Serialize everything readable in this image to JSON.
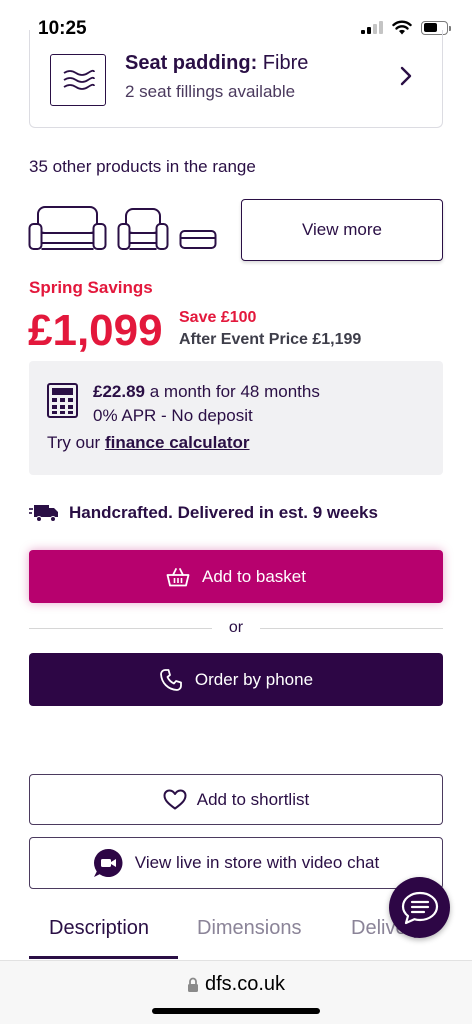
{
  "status_bar": {
    "time": "10:25"
  },
  "padding_card": {
    "title_label": "Seat padding:",
    "title_value": "Fibre",
    "subtitle": "2 seat fillings available"
  },
  "range": {
    "text": "35 other products in the range",
    "view_more_label": "View more"
  },
  "pricing": {
    "promo_label": "Spring Savings",
    "price": "£1,099",
    "save_text": "Save £100",
    "after_event_text": "After Event Price £1,199"
  },
  "finance": {
    "monthly_amount": "£22.89",
    "monthly_rest": "a month for 48 months",
    "apr_text": "0% APR - No deposit",
    "try_text": "Try our",
    "link_text": "finance calculator"
  },
  "delivery": {
    "text": "Handcrafted. Delivered in est. 9 weeks"
  },
  "actions": {
    "add_to_basket": "Add to basket",
    "or_text": "or",
    "order_by_phone": "Order by phone",
    "add_to_shortlist": "Add to shortlist",
    "video_chat": "View live in store with video chat"
  },
  "tabs": [
    {
      "label": "Description",
      "active": true
    },
    {
      "label": "Dimensions",
      "active": false
    },
    {
      "label": "Delivery",
      "active": false
    }
  ],
  "browser": {
    "url": "dfs.co.uk"
  },
  "colors": {
    "primary_text": "#2a0f45",
    "sale_red": "#e3183c",
    "basket_magenta": "#b7016e",
    "phone_purple": "#2d0645"
  },
  "icons": [
    "cellular-signal-icon",
    "wifi-icon",
    "battery-icon",
    "cushion-filling-icon",
    "chevron-right-icon",
    "three-seater-sofa-icon",
    "armchair-icon",
    "footstool-icon",
    "calculator-icon",
    "delivery-truck-icon",
    "basket-icon",
    "phone-icon",
    "heart-icon",
    "video-chat-icon",
    "chat-bubble-icon",
    "lock-icon"
  ]
}
